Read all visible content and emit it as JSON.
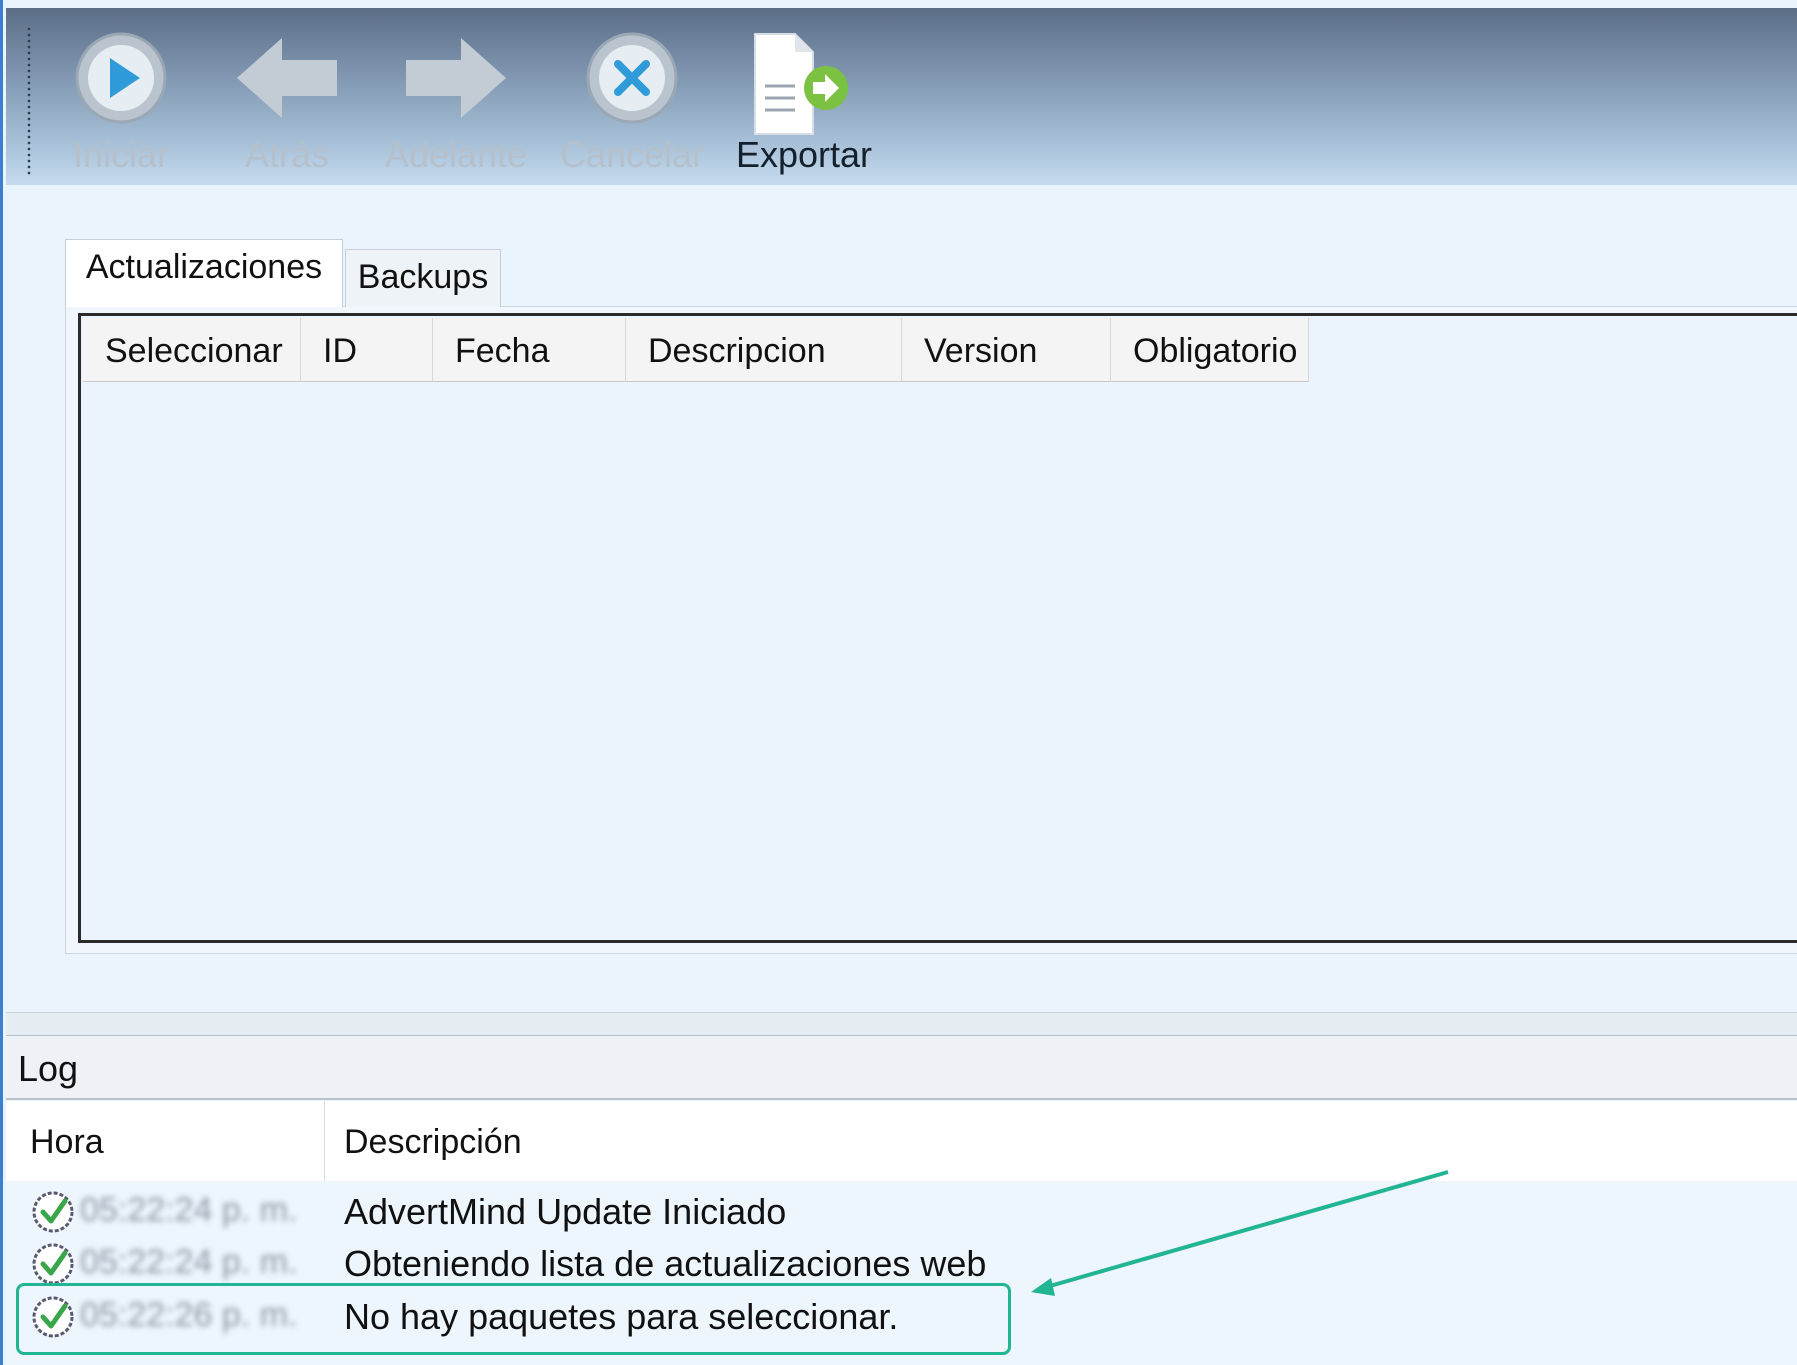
{
  "toolbar": {
    "buttons": [
      {
        "label": "Iniciar",
        "icon": "play-circle-icon",
        "enabled": false
      },
      {
        "label": "Atrás",
        "icon": "arrow-left-icon",
        "enabled": false
      },
      {
        "label": "Adelante",
        "icon": "arrow-right-icon",
        "enabled": false
      },
      {
        "label": "Cancelar",
        "icon": "cancel-circle-icon",
        "enabled": false
      },
      {
        "label": "Exportar",
        "icon": "export-document-icon",
        "enabled": true
      }
    ]
  },
  "tabs": [
    {
      "label": "Actualizaciones",
      "selected": true
    },
    {
      "label": "Backups",
      "selected": false
    }
  ],
  "grid": {
    "columns": [
      "Seleccionar",
      "ID",
      "Fecha",
      "Descripcion",
      "Version",
      "Obligatorio"
    ],
    "rows": []
  },
  "log": {
    "title": "Log",
    "columns": [
      "Hora",
      "Descripción"
    ],
    "entries": [
      {
        "time": "05:22:24 p. m.",
        "description": "AdvertMind Update Iniciado",
        "status": "success"
      },
      {
        "time": "05:22:24 p. m.",
        "description": "Obteniendo lista de actualizaciones web",
        "status": "success"
      },
      {
        "time": "05:22:26 p. m.",
        "description": "No hay paquetes para seleccionar.",
        "status": "success"
      }
    ]
  },
  "colors": {
    "accent_highlight": "#22b594",
    "window_border": "#3a7fd0",
    "check_green": "#3aa64a"
  }
}
